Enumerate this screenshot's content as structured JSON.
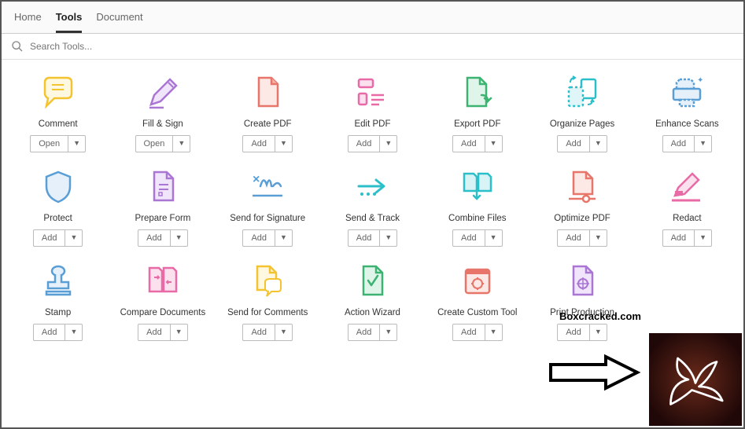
{
  "tabs": {
    "home": "Home",
    "tools": "Tools",
    "document": "Document"
  },
  "search": {
    "placeholder": "Search Tools..."
  },
  "actions": {
    "open": "Open",
    "add": "Add",
    "drop": "▼"
  },
  "tools": [
    {
      "label": "Comment",
      "action": "open"
    },
    {
      "label": "Fill & Sign",
      "action": "open"
    },
    {
      "label": "Create PDF",
      "action": "add"
    },
    {
      "label": "Edit PDF",
      "action": "add"
    },
    {
      "label": "Export PDF",
      "action": "add"
    },
    {
      "label": "Organize Pages",
      "action": "add"
    },
    {
      "label": "Enhance Scans",
      "action": "add"
    },
    {
      "label": "Protect",
      "action": "add"
    },
    {
      "label": "Prepare Form",
      "action": "add"
    },
    {
      "label": "Send for Signature",
      "action": "add"
    },
    {
      "label": "Send & Track",
      "action": "add"
    },
    {
      "label": "Combine Files",
      "action": "add"
    },
    {
      "label": "Optimize PDF",
      "action": "add"
    },
    {
      "label": "Redact",
      "action": "add"
    },
    {
      "label": "Stamp",
      "action": "add"
    },
    {
      "label": "Compare Documents",
      "action": "add"
    },
    {
      "label": "Send for Comments",
      "action": "add"
    },
    {
      "label": "Action Wizard",
      "action": "add"
    },
    {
      "label": "Create Custom Tool",
      "action": "add"
    },
    {
      "label": "Print Production",
      "action": "add"
    }
  ],
  "watermark": "Boxcracked.com"
}
